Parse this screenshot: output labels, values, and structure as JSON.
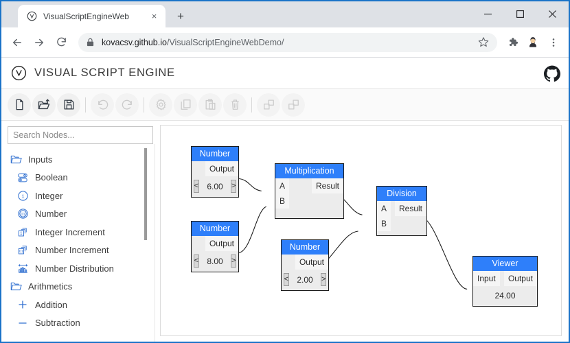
{
  "browser": {
    "tab": {
      "title": "VisualScriptEngineWeb",
      "favicon": "visual-script-engine-icon",
      "close_label": "×"
    },
    "new_tab_label": "+",
    "window_controls": {
      "minimize": "−",
      "maximize": "□",
      "close": "✕"
    },
    "nav": {
      "back": "back-icon",
      "forward": "forward-icon",
      "reload": "reload-icon"
    },
    "omnibox": {
      "lock": "lock-icon",
      "url_host": "kovacsv.github.io",
      "url_path": "/VisualScriptEngineWebDemo/",
      "star": "bookmark-star-icon"
    },
    "toolbar_icons": [
      "extensions-puzzle-icon",
      "profile-avatar-icon",
      "browser-menu-icon"
    ]
  },
  "app": {
    "logo": "visual-script-engine-logo",
    "title": "VISUAL SCRIPT ENGINE",
    "github_link": "github-icon",
    "toolbar": [
      {
        "name": "new",
        "icon": "new-file-icon",
        "enabled": true
      },
      {
        "name": "open",
        "icon": "open-folder-icon",
        "enabled": true
      },
      {
        "name": "save",
        "icon": "save-disk-icon",
        "enabled": true
      },
      {
        "name": "separator-1",
        "icon": "separator",
        "enabled": false
      },
      {
        "name": "undo",
        "icon": "undo-icon",
        "enabled": false
      },
      {
        "name": "redo",
        "icon": "redo-icon",
        "enabled": false
      },
      {
        "name": "separator-2",
        "icon": "separator",
        "enabled": false
      },
      {
        "name": "settings",
        "icon": "gear-icon",
        "enabled": false
      },
      {
        "name": "copy",
        "icon": "copy-icon",
        "enabled": false
      },
      {
        "name": "paste",
        "icon": "paste-icon",
        "enabled": false
      },
      {
        "name": "delete",
        "icon": "trash-icon",
        "enabled": false
      },
      {
        "name": "separator-3",
        "icon": "separator",
        "enabled": false
      },
      {
        "name": "group",
        "icon": "group-icon",
        "enabled": false
      },
      {
        "name": "ungroup",
        "icon": "ungroup-icon",
        "enabled": false
      }
    ]
  },
  "sidebar": {
    "search": {
      "placeholder": "Search Nodes...",
      "value": ""
    },
    "items": [
      {
        "label": "Inputs",
        "icon": "folder-icon",
        "type": "group"
      },
      {
        "label": "Boolean",
        "icon": "boolean-toggle-icon",
        "type": "item"
      },
      {
        "label": "Integer",
        "icon": "integer-circle-icon",
        "type": "item"
      },
      {
        "label": "Number",
        "icon": "number-circle-icon",
        "type": "item"
      },
      {
        "label": "Integer Increment",
        "icon": "integer-increment-icon",
        "type": "item"
      },
      {
        "label": "Number Increment",
        "icon": "number-increment-icon",
        "type": "item"
      },
      {
        "label": "Number Distribution",
        "icon": "number-distribution-icon",
        "type": "item"
      },
      {
        "label": "Arithmetics",
        "icon": "folder-icon",
        "type": "group"
      },
      {
        "label": "Addition",
        "icon": "plus-icon",
        "type": "item"
      },
      {
        "label": "Subtraction",
        "icon": "minus-icon",
        "type": "item"
      }
    ]
  },
  "graph": {
    "accent_color": "#2e7ffa",
    "nodes": [
      {
        "id": "num1",
        "title": "Number",
        "out_label": "Output",
        "value": "6.00",
        "dec": "<",
        "inc": ">"
      },
      {
        "id": "num2",
        "title": "Number",
        "out_label": "Output",
        "value": "8.00",
        "dec": "<",
        "inc": ">"
      },
      {
        "id": "num3",
        "title": "Number",
        "out_label": "Output",
        "value": "2.00",
        "dec": "<",
        "inc": ">"
      },
      {
        "id": "mult",
        "title": "Multiplication",
        "in_a": "A",
        "in_b": "B",
        "out_label": "Result"
      },
      {
        "id": "div",
        "title": "Division",
        "in_a": "A",
        "in_b": "B",
        "out_label": "Result"
      },
      {
        "id": "view",
        "title": "Viewer",
        "in_label": "Input",
        "out_label": "Output",
        "value": "24.00"
      }
    ]
  }
}
